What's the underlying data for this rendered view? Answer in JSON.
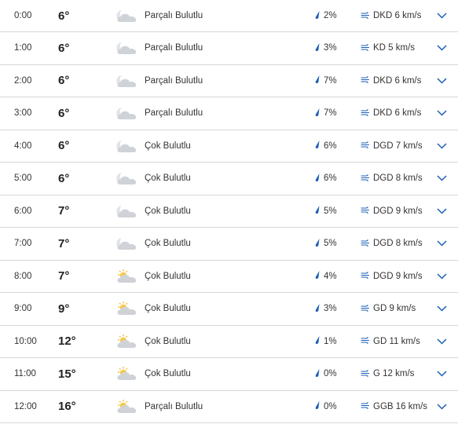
{
  "colors": {
    "accent": "#1a73e8",
    "divider": "#d6d6d6",
    "cloud": "#cfd3d8",
    "sun": "#f4c542"
  },
  "hourly": [
    {
      "time": "0:00",
      "temp": "6°",
      "icon": "partly-cloudy-night-icon",
      "condition": "Parçalı Bulutlu",
      "rain": "2%",
      "wind": "DKD 6 km/s"
    },
    {
      "time": "1:00",
      "temp": "6°",
      "icon": "partly-cloudy-night-icon",
      "condition": "Parçalı Bulutlu",
      "rain": "3%",
      "wind": "KD 5 km/s"
    },
    {
      "time": "2:00",
      "temp": "6°",
      "icon": "partly-cloudy-night-icon",
      "condition": "Parçalı Bulutlu",
      "rain": "7%",
      "wind": "DKD 6 km/s"
    },
    {
      "time": "3:00",
      "temp": "6°",
      "icon": "partly-cloudy-night-icon",
      "condition": "Parçalı Bulutlu",
      "rain": "7%",
      "wind": "DKD 6 km/s"
    },
    {
      "time": "4:00",
      "temp": "6°",
      "icon": "mostly-cloudy-night-icon",
      "condition": "Çok Bulutlu",
      "rain": "6%",
      "wind": "DGD 7 km/s"
    },
    {
      "time": "5:00",
      "temp": "6°",
      "icon": "mostly-cloudy-night-icon",
      "condition": "Çok Bulutlu",
      "rain": "6%",
      "wind": "DGD 8 km/s"
    },
    {
      "time": "6:00",
      "temp": "7°",
      "icon": "mostly-cloudy-night-icon",
      "condition": "Çok Bulutlu",
      "rain": "5%",
      "wind": "DGD 9 km/s"
    },
    {
      "time": "7:00",
      "temp": "7°",
      "icon": "mostly-cloudy-night-icon",
      "condition": "Çok Bulutlu",
      "rain": "5%",
      "wind": "DGD 8 km/s"
    },
    {
      "time": "8:00",
      "temp": "7°",
      "icon": "mostly-cloudy-day-icon",
      "condition": "Çok Bulutlu",
      "rain": "4%",
      "wind": "DGD 9 km/s"
    },
    {
      "time": "9:00",
      "temp": "9°",
      "icon": "mostly-cloudy-day-icon",
      "condition": "Çok Bulutlu",
      "rain": "3%",
      "wind": "GD 9 km/s"
    },
    {
      "time": "10:00",
      "temp": "12°",
      "icon": "mostly-cloudy-day-icon",
      "condition": "Çok Bulutlu",
      "rain": "1%",
      "wind": "GD 11 km/s"
    },
    {
      "time": "11:00",
      "temp": "15°",
      "icon": "mostly-cloudy-day-icon",
      "condition": "Çok Bulutlu",
      "rain": "0%",
      "wind": "G 12 km/s"
    },
    {
      "time": "12:00",
      "temp": "16°",
      "icon": "partly-cloudy-day-icon",
      "condition": "Parçalı Bulutlu",
      "rain": "0%",
      "wind": "GGB 16 km/s"
    }
  ]
}
